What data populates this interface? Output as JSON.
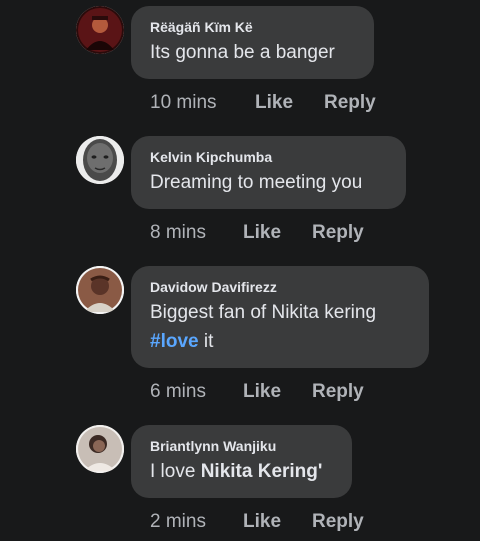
{
  "comments": [
    {
      "author": "Rëägäñ Kïm Kë",
      "text": "Its gonna be a banger",
      "time": "10 mins",
      "like": "Like",
      "reply": "Reply"
    },
    {
      "author": "Kelvin Kipchumba",
      "text": "Dreaming to meeting you",
      "time": "8 mins",
      "like": "Like",
      "reply": "Reply"
    },
    {
      "author": "Davidow Davifirezz",
      "text_line1": "Biggest fan of Nikita kering",
      "hashtag": "#love",
      "text_after_hashtag": " it",
      "time": "6 mins",
      "like": "Like",
      "reply": "Reply"
    },
    {
      "author": "Briantlynn Wanjiku",
      "text_prefix": "I love ",
      "text_strong": "Nikita Kering'",
      "time": "2 mins",
      "like": "Like",
      "reply": "Reply"
    }
  ],
  "colors": {
    "background": "#18191a",
    "bubble": "#3a3b3c",
    "hashtag": "#5aa7ff",
    "meta": "#b0b3b8"
  }
}
